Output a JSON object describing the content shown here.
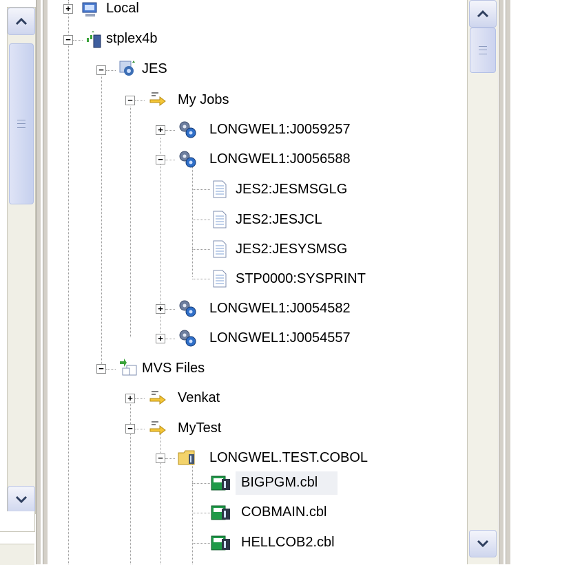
{
  "tree": {
    "nodes": [
      {
        "id": "local",
        "label": "Local",
        "expander": "+",
        "icon": "computer-icon"
      },
      {
        "id": "stplex4b",
        "label": "stplex4b",
        "expander": "−",
        "icon": "system-connection-icon"
      },
      {
        "id": "jes",
        "label": "JES",
        "expander": "−",
        "icon": "jes-subsystem-icon"
      },
      {
        "id": "my-jobs",
        "label": "My Jobs",
        "expander": "−",
        "icon": "filter-icon"
      },
      {
        "id": "job1",
        "label": "LONGWEL1:J0059257",
        "expander": "+",
        "icon": "job-gears-icon"
      },
      {
        "id": "job2",
        "label": "LONGWEL1:J0056588",
        "expander": "−",
        "icon": "job-gears-icon"
      },
      {
        "id": "spool1",
        "label": "JES2:JESMSGLG",
        "expander": "",
        "icon": "spool-file-icon"
      },
      {
        "id": "spool2",
        "label": "JES2:JESJCL",
        "expander": "",
        "icon": "spool-file-icon"
      },
      {
        "id": "spool3",
        "label": "JES2:JESYSMSG",
        "expander": "",
        "icon": "spool-file-icon"
      },
      {
        "id": "spool4",
        "label": "STP0000:SYSPRINT",
        "expander": "",
        "icon": "spool-file-icon"
      },
      {
        "id": "job3",
        "label": "LONGWEL1:J0054582",
        "expander": "+",
        "icon": "job-gears-icon"
      },
      {
        "id": "job4",
        "label": "LONGWEL1:J0054557",
        "expander": "+",
        "icon": "job-gears-icon"
      },
      {
        "id": "mvs",
        "label": "MVS Files",
        "expander": "−",
        "icon": "mvs-files-icon"
      },
      {
        "id": "venkat",
        "label": "Venkat",
        "expander": "+",
        "icon": "filter-icon"
      },
      {
        "id": "mytest",
        "label": "MyTest",
        "expander": "−",
        "icon": "filter-icon"
      },
      {
        "id": "pds",
        "label": "LONGWEL.TEST.COBOL",
        "expander": "−",
        "icon": "folder-dataset-icon"
      },
      {
        "id": "m1",
        "label": "BIGPGM.cbl",
        "expander": "",
        "icon": "cobol-member-icon",
        "selected": true
      },
      {
        "id": "m2",
        "label": "COBMAIN.cbl",
        "expander": "",
        "icon": "cobol-member-icon"
      },
      {
        "id": "m3",
        "label": "HELLCOB2.cbl",
        "expander": "",
        "icon": "cobol-member-icon"
      }
    ]
  }
}
